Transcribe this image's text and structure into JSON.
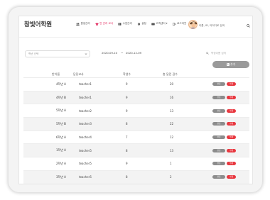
{
  "header": {
    "brand": "참빛어학원",
    "nav": [
      {
        "label": "원생관리",
        "icon": "users-icon",
        "active": false
      },
      {
        "label": "반 관리 교사",
        "icon": "class-icon",
        "active": true
      },
      {
        "label": "수업관리",
        "icon": "book-icon",
        "active": false
      },
      {
        "label": "설정",
        "icon": "gear-icon",
        "active": false
      },
      {
        "label": "고객센터 ▾",
        "icon": "support-icon",
        "active": false
      },
      {
        "label": "로그아웃",
        "icon": "logout-icon",
        "active": false
      }
    ],
    "search_placeholder": "이름, ID, 아이디로 검색"
  },
  "filters": {
    "class_select": "학년 선택",
    "date_from": "2020-09-10",
    "date_sep": "~",
    "date_to": "2020-12-09",
    "student_search_placeholder": "학생이름 검색"
  },
  "add_button": "추가",
  "table": {
    "columns": [
      "반이름",
      "담당교사",
      "학생수",
      "총 달린 권수"
    ],
    "action_labels": {
      "edit": "편집",
      "delete": "삭제"
    },
    "rows": [
      {
        "class": "4학년 A",
        "teacher": "teacher1",
        "students": "9",
        "books": "20"
      },
      {
        "class": "4학년 B",
        "teacher": "teacher1",
        "students": "9",
        "books": "16"
      },
      {
        "class": "5학년 A",
        "teacher": "teacher2",
        "students": "9",
        "books": "13"
      },
      {
        "class": "5학년 B",
        "teacher": "teacher3",
        "students": "8",
        "books": "22"
      },
      {
        "class": "6학년 A",
        "teacher": "teacher4",
        "students": "7",
        "books": "12"
      },
      {
        "class": "1학년 A",
        "teacher": "teacher5",
        "students": "8",
        "books": "13"
      },
      {
        "class": "2학년 A",
        "teacher": "teacher5",
        "students": "9",
        "books": "1"
      },
      {
        "class": "3학년 A",
        "teacher": "teacher5",
        "students": "8",
        "books": "2"
      }
    ]
  },
  "colors": {
    "accent": "#e2245a",
    "delete": "#e8373f",
    "button_gray": "#8c8c8c"
  }
}
